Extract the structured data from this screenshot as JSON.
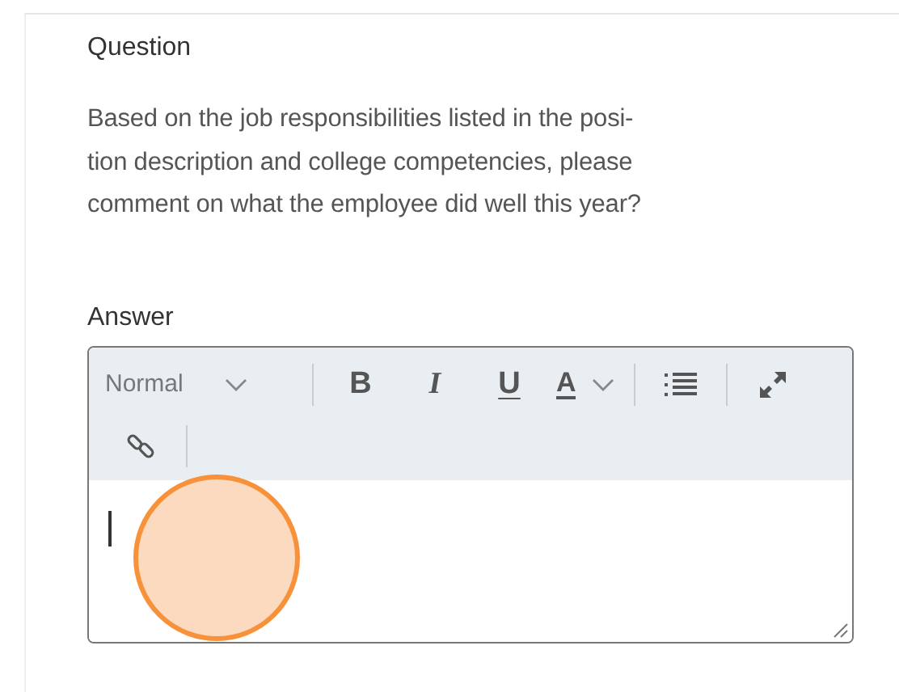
{
  "question": {
    "label": "Question",
    "lines": [
      "Based on the job responsibilities listed in the posi-",
      "tion description and college competencies, please",
      "comment on what the employee did well this year?"
    ]
  },
  "answer": {
    "label": "Answer",
    "toolbar": [
      {
        "kind": "select",
        "label": "Normal"
      },
      {
        "kind": "divider"
      },
      {
        "kind": "bold",
        "label": "B"
      },
      {
        "kind": "italic",
        "label": "I"
      },
      {
        "kind": "underline",
        "label": "U"
      },
      {
        "kind": "color",
        "label": "A"
      },
      {
        "kind": "divider"
      },
      {
        "kind": "list"
      },
      {
        "kind": "divider"
      },
      {
        "kind": "expand"
      },
      {
        "kind": "break"
      },
      {
        "kind": "link"
      },
      {
        "kind": "divider"
      }
    ]
  }
}
